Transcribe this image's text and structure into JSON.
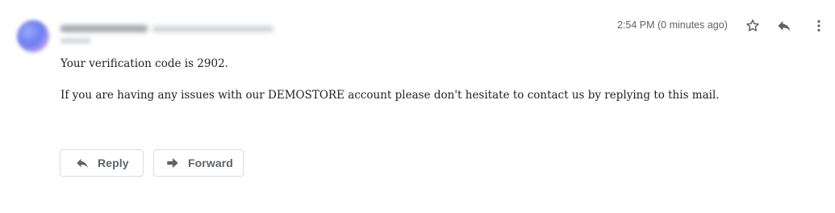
{
  "message": {
    "timestamp": "2:54 PM (0 minutes ago)",
    "body_line1": "Your verification code is 2902.",
    "body_line2": "If you are having any issues with our DEMOSTORE account please don't hesitate to contact us by replying to this mail."
  },
  "header_icons": {
    "star": "star-icon",
    "reply": "reply-icon",
    "more": "more-vert-icon"
  },
  "actions": {
    "reply_label": "Reply",
    "forward_label": "Forward"
  },
  "colors": {
    "secondary_text": "#5f6368",
    "border": "#dadce0",
    "body_text": "#222222"
  }
}
